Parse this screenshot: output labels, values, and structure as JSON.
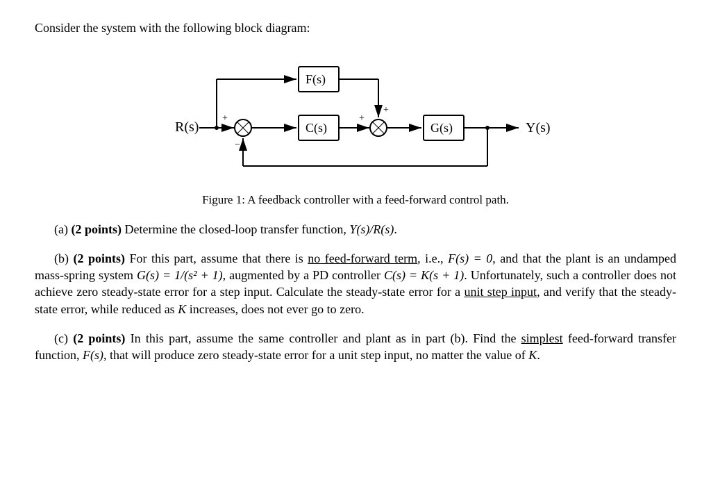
{
  "intro": "Consider the system with the following block diagram:",
  "diagram": {
    "labels": {
      "R": "R(s)",
      "F": "F(s)",
      "C": "C(s)",
      "G": "G(s)",
      "Y": "Y(s)",
      "plus1": "+",
      "minus1": "−",
      "plus2a": "+",
      "plus2b": "+"
    }
  },
  "figure_caption": "Figure 1: A feedback controller with a feed-forward control path.",
  "qa": {
    "label": "(a)",
    "points": "(2 points)",
    "text_1": " Determine the closed-loop transfer function, ",
    "tf": "Y(s)/R(s)",
    "text_2": "."
  },
  "qb": {
    "label": "(b)",
    "points": "(2 points)",
    "t1": " For this part, assume that there is ",
    "u1": "no feed-forward term",
    "t2": ", i.e., ",
    "eq1": "F(s) = 0",
    "t3": ", and that the plant is an undamped mass-spring system ",
    "eq2": "G(s) = 1/(s² + 1)",
    "t4": ", augmented by a PD controller ",
    "eq3": "C(s) = K(s + 1)",
    "t5": ". Unfortunately, such a controller does not achieve zero steady-state error for a step input. Calculate the steady-state error for a ",
    "u2": "unit step input",
    "t6": ", and verify that the steady-state error, while reduced as ",
    "K": "K",
    "t7": " increases, does not ever go to zero."
  },
  "qc": {
    "label": "(c)",
    "points": "(2 points)",
    "t1": " In this part, assume the same controller and plant as in part (b). Find the ",
    "u1": "simplest",
    "t2": " feed-forward transfer function, ",
    "eq1": "F(s)",
    "t3": ", that will produce zero steady-state error for a unit step input, no matter the value of ",
    "K": "K",
    "t4": "."
  }
}
